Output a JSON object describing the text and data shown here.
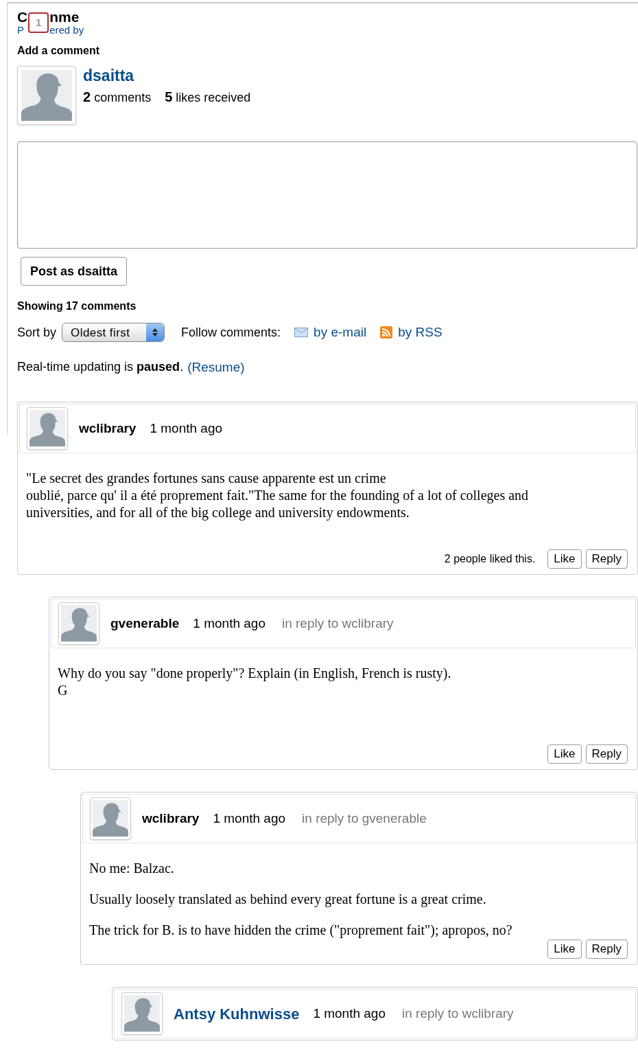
{
  "header": {
    "title_start": "C",
    "title_end": "nme",
    "byline_start": "P",
    "byline_end": "ered by",
    "badge": "1"
  },
  "composer": {
    "heading": "Add a comment",
    "user": "dsaitta",
    "comments_count": "2",
    "comments_label": "comments",
    "likes_count": "5",
    "likes_label": "likes received",
    "button": "Post as dsaitta"
  },
  "listing": {
    "count_text": "Showing 17 comments",
    "sort_label": "Sort by",
    "sort_value": "Oldest first",
    "follow_label": "Follow comments:",
    "email_link": "by e-mail",
    "rss_link": "by RSS",
    "status_text": "Real-time updating is **paused**.",
    "resume_link": "(Resume)"
  },
  "comments": [
    {
      "author": "wclibrary",
      "author_link": false,
      "time": "1 month ago",
      "paragraphs": [
        "\"Le secret des grandes fortunes sans cause apparente est un crime\noublié, parce qu' il a été proprement fait.\"The same for the founding of a lot of colleges and universities, and for all of the big college and university endowments."
      ],
      "likes_text": "2 people liked this.",
      "like": "Like",
      "reply": "Reply",
      "children": [
        {
          "author": "gvenerable",
          "author_link": false,
          "time": "1 month ago",
          "in_reply": "in reply to wclibrary",
          "paragraphs": [
            " Why do you say \"done properly\"?  Explain (in English, French is rusty).\nG"
          ],
          "like": "Like",
          "reply": "Reply",
          "children": [
            {
              "author": "wclibrary",
              "author_link": false,
              "time": "1 month ago",
              "in_reply": "in reply to gvenerable",
              "paragraphs": [
                "No me: Balzac.",
                "Usually loosely translated as behind every great fortune is a great crime.",
                "The trick for B. is to have hidden the crime (\"proprement fait\"); apropos, no?"
              ],
              "like": "Like",
              "reply": "Reply",
              "children": [
                {
                  "author": "Antsy Kuhnwisse",
                  "author_link": true,
                  "time": "1 month ago",
                  "in_reply": "in reply to wclibrary"
                }
              ]
            }
          ]
        }
      ]
    }
  ]
}
